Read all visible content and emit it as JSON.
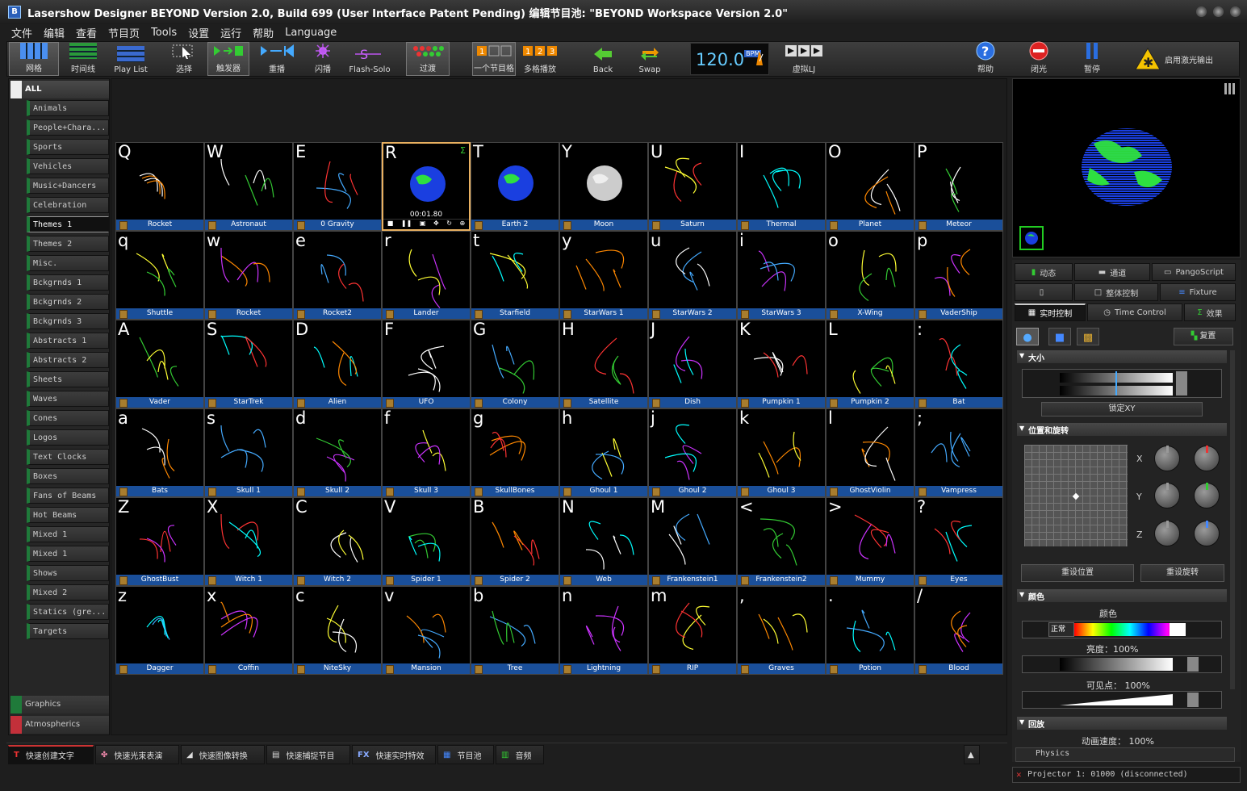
{
  "title": "Lasershow Designer BEYOND   Version 2.0, Build 699   (User Interface Patent Pending)   编辑节目池: \"BEYOND Workspace Version 2.0\"",
  "menu": [
    "文件",
    "编辑",
    "查看",
    "节目页",
    "Tools",
    "设置",
    "运行",
    "帮助",
    "Language"
  ],
  "toolbar": {
    "grid": "网格",
    "timeline": "时间线",
    "playlist": "Play List",
    "select": "选择",
    "trigger": "触发器",
    "repeat": "重播",
    "flash": "闪播",
    "flashsolo": "Flash-Solo",
    "fade": "过渡",
    "single": "一个节目格",
    "multi": "多格播放",
    "back": "Back",
    "swap": "Swap",
    "bpm": "120.0",
    "bpm_unit": "BPM",
    "virtual_lj": "虚拟LJ",
    "help": "帮助",
    "blackout": "闭光",
    "pause": "暂停",
    "enable_laser": "启用激光输出"
  },
  "sidebar": {
    "all": "ALL",
    "categories": [
      "Animals",
      "People+Chara...",
      "Sports",
      "Vehicles",
      "Music+Dancers",
      "Celebration",
      "Themes 1",
      "Themes 2",
      "Misc.",
      "Bckgrnds 1",
      "Bckgrnds 2",
      "Bckgrnds 3",
      "Abstracts 1",
      "Abstracts 2",
      "Sheets",
      "Waves",
      "Cones",
      "Logos",
      "Text  Clocks",
      "Boxes",
      "Fans of Beams",
      "Hot Beams",
      "Mixed 1",
      "Mixed 1",
      "Shows",
      "Mixed 2",
      "Statics (gre...",
      "Targets"
    ],
    "selected": "Themes 1",
    "groups": [
      "Graphics",
      "Atmospherics"
    ]
  },
  "cues": [
    [
      {
        "k": "Q",
        "n": "Rocket"
      },
      {
        "k": "W",
        "n": "Astronaut"
      },
      {
        "k": "E",
        "n": "0 Gravity"
      },
      {
        "k": "R",
        "n": "",
        "time": "00:01.80"
      },
      {
        "k": "T",
        "n": "Earth 2"
      },
      {
        "k": "Y",
        "n": "Moon"
      },
      {
        "k": "U",
        "n": "Saturn"
      },
      {
        "k": "I",
        "n": "Thermal"
      },
      {
        "k": "O",
        "n": "Planet"
      },
      {
        "k": "P",
        "n": "Meteor"
      }
    ],
    [
      {
        "k": "q",
        "n": "Shuttle"
      },
      {
        "k": "w",
        "n": "Rocket"
      },
      {
        "k": "e",
        "n": "Rocket2"
      },
      {
        "k": "r",
        "n": "Lander"
      },
      {
        "k": "t",
        "n": "Starfield"
      },
      {
        "k": "y",
        "n": "StarWars 1"
      },
      {
        "k": "u",
        "n": "StarWars 2"
      },
      {
        "k": "i",
        "n": "StarWars 3"
      },
      {
        "k": "o",
        "n": "X-Wing"
      },
      {
        "k": "p",
        "n": "VaderShip"
      }
    ],
    [
      {
        "k": "A",
        "n": "Vader"
      },
      {
        "k": "S",
        "n": "StarTrek"
      },
      {
        "k": "D",
        "n": "Alien"
      },
      {
        "k": "F",
        "n": "UFO"
      },
      {
        "k": "G",
        "n": "Colony"
      },
      {
        "k": "H",
        "n": "Satellite"
      },
      {
        "k": "J",
        "n": "Dish"
      },
      {
        "k": "K",
        "n": "Pumpkin 1"
      },
      {
        "k": "L",
        "n": "Pumpkin 2"
      },
      {
        "k": ":",
        "n": "Bat"
      }
    ],
    [
      {
        "k": "a",
        "n": "Bats"
      },
      {
        "k": "s",
        "n": "Skull 1"
      },
      {
        "k": "d",
        "n": "Skull 2"
      },
      {
        "k": "f",
        "n": "Skull 3"
      },
      {
        "k": "g",
        "n": "SkullBones"
      },
      {
        "k": "h",
        "n": "Ghoul 1"
      },
      {
        "k": "j",
        "n": "Ghoul 2"
      },
      {
        "k": "k",
        "n": "Ghoul 3"
      },
      {
        "k": "l",
        "n": "GhostViolin"
      },
      {
        "k": ";",
        "n": "Vampress"
      }
    ],
    [
      {
        "k": "Z",
        "n": "GhostBust"
      },
      {
        "k": "X",
        "n": "Witch 1"
      },
      {
        "k": "C",
        "n": "Witch 2"
      },
      {
        "k": "V",
        "n": "Spider 1"
      },
      {
        "k": "B",
        "n": "Spider 2"
      },
      {
        "k": "N",
        "n": "Web"
      },
      {
        "k": "M",
        "n": "Frankenstein1"
      },
      {
        "k": "<",
        "n": "Frankenstein2"
      },
      {
        "k": ">",
        "n": "Mummy"
      },
      {
        "k": "?",
        "n": "Eyes"
      }
    ],
    [
      {
        "k": "z",
        "n": "Dagger"
      },
      {
        "k": "x",
        "n": "Coffin"
      },
      {
        "k": "c",
        "n": "NiteSky"
      },
      {
        "k": "v",
        "n": "Mansion"
      },
      {
        "k": "b",
        "n": "Tree"
      },
      {
        "k": "n",
        "n": "Lightning"
      },
      {
        "k": "m",
        "n": "RIP"
      },
      {
        "k": ",",
        "n": "Graves"
      },
      {
        "k": ".",
        "n": "Potion"
      },
      {
        "k": "/",
        "n": "Blood"
      }
    ]
  ],
  "right": {
    "tabs": [
      "动态",
      "通道",
      "PangoScript",
      "",
      "整体控制",
      "Fixture",
      "实时控制",
      "Time Control",
      "效果"
    ],
    "reset": "复置",
    "size_section": "大小",
    "lock_xy": "锁定XY",
    "pos_section": "位置和旋转",
    "axis_x": "X",
    "axis_y": "Y",
    "axis_z": "Z",
    "reset_pos": "重设位置",
    "reset_rot": "重设旋转",
    "color_section": "颜色",
    "color_label": "颜色",
    "normal": "正常",
    "brightness": "亮度：100%",
    "visible_points": "可见点：  100%",
    "playback_section": "回放",
    "anim_speed": "动画速度：  100%",
    "physics": "Physics"
  },
  "bottom": [
    "快速创建文字",
    "快速光束表演",
    "快速图像转换",
    "快速捕捉节目",
    "快速实时特效",
    "节目池",
    "音频"
  ],
  "status": "Projector 1: 01000 (disconnected)"
}
